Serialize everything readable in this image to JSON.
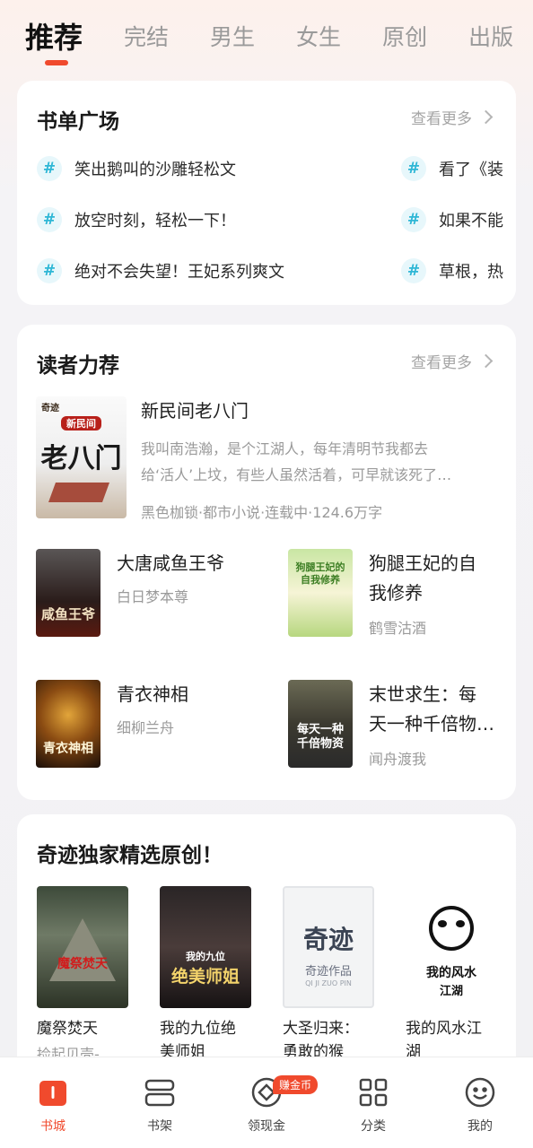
{
  "top_tabs": {
    "items": [
      "推荐",
      "完结",
      "男生",
      "女生",
      "原创",
      "出版"
    ],
    "active": "推荐"
  },
  "booklist": {
    "title": "书单广场",
    "more": "查看更多",
    "items": [
      "笑出鹅叫的沙雕轻松文",
      "看了《装",
      "放空时刻，轻松一下！",
      "如果不能",
      "绝对不会失望！王妃系列爽文",
      "草根，热"
    ]
  },
  "reader": {
    "title": "读者力荐",
    "more": "查看更多",
    "featured": {
      "title": "新民间老八门",
      "desc_line1": "我叫南浩瀚，是个江湖人，每年清明节我都去",
      "desc_line2": "给‘活人’上坟，有些人虽然活着，可早就该死了…",
      "meta": "黑色枷锁·都市小说·连载中·124.6万字",
      "cover_brand": "奇迹",
      "cover_text": "老八门",
      "cover_sub": "新民间"
    },
    "grid": [
      {
        "title": "大唐咸鱼王爷",
        "author": "白日梦本尊",
        "cover_text": "咸鱼王爷"
      },
      {
        "title_line1": "狗腿王妃的自",
        "title_line2": "我修养",
        "author": "鹤雪沽酒",
        "cover_text": "狗腿王妃的自我修养"
      },
      {
        "title": "青衣神相",
        "author": "细柳兰舟",
        "cover_text": "青衣神相"
      },
      {
        "title_line1": "末世求生：每",
        "title_line2": "天一种千倍物…",
        "author": "闻舟渡我",
        "cover_text": "每天一种千倍物资"
      }
    ]
  },
  "originals": {
    "title": "奇迹独家精选原创！",
    "items": [
      {
        "title": "魔祭焚天",
        "author": "捡起贝壳-",
        "cover_text": "魔祭焚天"
      },
      {
        "title_line1": "我的九位绝",
        "title_line2": "美师姐",
        "cover_text": "绝美师姐",
        "cover_sub": "我的九位"
      },
      {
        "title_line1": "大圣归来：",
        "title_line2": "勇敢的猴",
        "cover_text": "奇迹",
        "cover_sub": "奇迹作品",
        "cover_pinyin": "QI JI ZUO PIN"
      },
      {
        "title_line1": "我的风水江",
        "title_line2": "湖",
        "cover_text": "我的风水",
        "cover_sub": "江湖"
      }
    ]
  },
  "bottom_nav": {
    "items": [
      "书城",
      "书架",
      "领现金",
      "分类",
      "我的"
    ],
    "active": "书城",
    "badge": "赚金币"
  },
  "colors": {
    "accent": "#f04a2d",
    "hash": "#2fb7d6",
    "muted": "#9a9a9a"
  }
}
